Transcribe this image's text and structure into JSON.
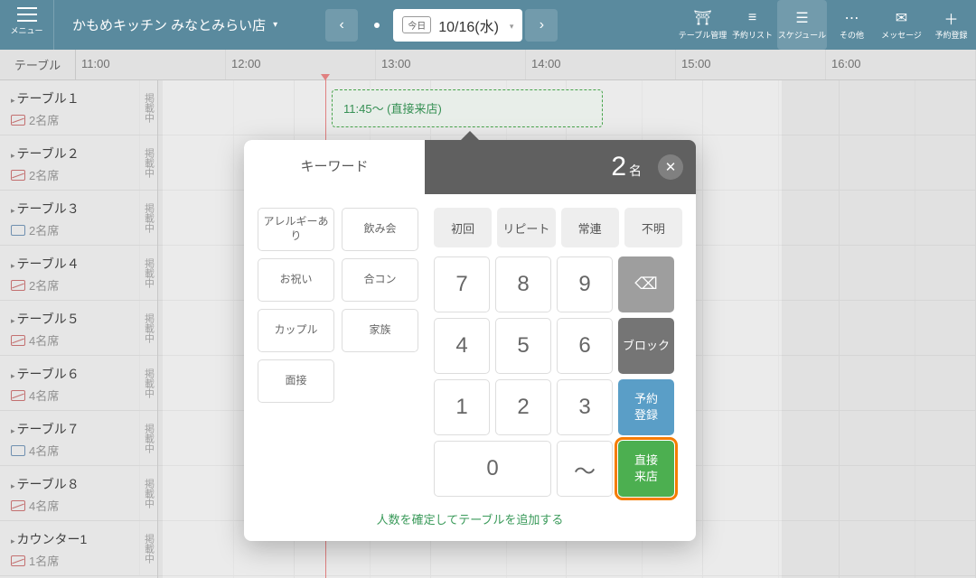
{
  "header": {
    "menu_label": "メニュー",
    "store_name": "かもめキッチン みなとみらい店",
    "today_badge": "今日",
    "date": "10/16(水)",
    "tools": [
      {
        "icon": "⛩",
        "label": "テーブル管理"
      },
      {
        "icon": "≡",
        "label": "予約リスト"
      },
      {
        "icon": "☰",
        "label": "スケジュール"
      },
      {
        "icon": "⋯",
        "label": "その他"
      },
      {
        "icon": "✉",
        "label": "メッセージ"
      },
      {
        "icon": "＋",
        "label": "予約登録"
      }
    ]
  },
  "timeline": {
    "table_header": "テーブル",
    "hours": [
      "11:00",
      "12:00",
      "13:00",
      "14:00",
      "15:00",
      "16:00"
    ],
    "tables": [
      {
        "name": "テーブル１",
        "seats": "2名席",
        "status": "掲載中",
        "red": true
      },
      {
        "name": "テーブル２",
        "seats": "2名席",
        "status": "掲載中",
        "red": true
      },
      {
        "name": "テーブル３",
        "seats": "2名席",
        "status": "掲載中",
        "red": false
      },
      {
        "name": "テーブル４",
        "seats": "2名席",
        "status": "掲載中",
        "red": true
      },
      {
        "name": "テーブル５",
        "seats": "4名席",
        "status": "掲載中",
        "red": true
      },
      {
        "name": "テーブル６",
        "seats": "4名席",
        "status": "掲載中",
        "red": true
      },
      {
        "name": "テーブル７",
        "seats": "4名席",
        "status": "掲載中",
        "red": false
      },
      {
        "name": "テーブル８",
        "seats": "4名席",
        "status": "掲載中",
        "red": true
      },
      {
        "name": "カウンター1",
        "seats": "1名席",
        "status": "掲載中",
        "red": true
      }
    ],
    "reservation": "11:45～ (直接来店)"
  },
  "popup": {
    "keyword_title": "キーワード",
    "count": "2",
    "count_unit": "名",
    "keywords": [
      "アレルギーあり",
      "飲み会",
      "お祝い",
      "合コン",
      "カップル",
      "家族",
      "面接"
    ],
    "types": [
      "初回",
      "リピート",
      "常連",
      "不明"
    ],
    "nums": [
      "7",
      "8",
      "9",
      "4",
      "5",
      "6",
      "1",
      "2",
      "3",
      "0",
      "～"
    ],
    "backspace": "⌫",
    "block": "ブロック",
    "reserve": "予約\n登録",
    "walkin": "直接\n来店",
    "footer": "人数を確定してテーブルを追加する"
  }
}
